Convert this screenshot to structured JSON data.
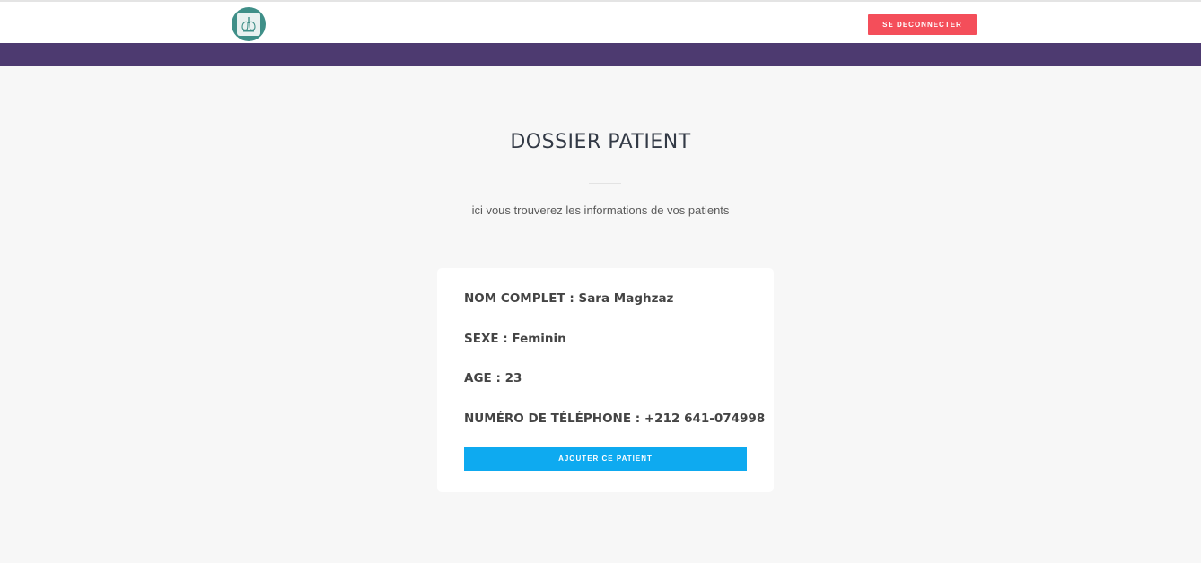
{
  "header": {
    "logout_label": "SE DECONNECTER"
  },
  "main": {
    "title": "DOSSIER PATIENT",
    "subtitle": "ici vous trouverez les informations de vos patients"
  },
  "patient": {
    "fullname": {
      "label": "NOM COMPLET",
      "value": "Sara Maghzaz"
    },
    "sex": {
      "label": "SEXE",
      "value": "Feminin"
    },
    "age": {
      "label": "AGE",
      "value": "23"
    },
    "phone": {
      "label": "NUMÉRO DE TÉLÉPHONE",
      "value": "+212 641-074998"
    }
  },
  "card": {
    "add_button_label": "AJOUTER CE PATIENT"
  },
  "colors": {
    "band": "#4d3a70",
    "logout": "#f44e5a",
    "add_button": "#0eaaf0",
    "logo": "#3f8f88"
  },
  "icons": {
    "logo": "clinic-logo-icon"
  }
}
